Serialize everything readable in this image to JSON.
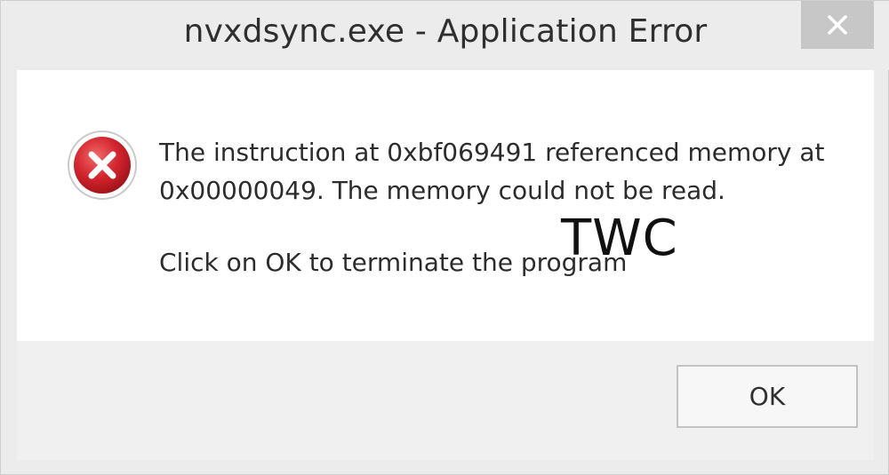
{
  "window": {
    "title": "nvxdsync.exe - Application Error",
    "close_icon": "close-x-icon"
  },
  "message": {
    "icon": "error-circle-x-icon",
    "line1": "The instruction at 0xbf069491 referenced memory at",
    "line2": "0x00000049. The memory could not be read.",
    "line3": "Click on OK to terminate the program"
  },
  "watermark": "TWC",
  "buttons": {
    "ok_label": "OK"
  },
  "colors": {
    "error_red": "#c8202a",
    "background": "#ececec",
    "content_bg": "#ffffff"
  }
}
